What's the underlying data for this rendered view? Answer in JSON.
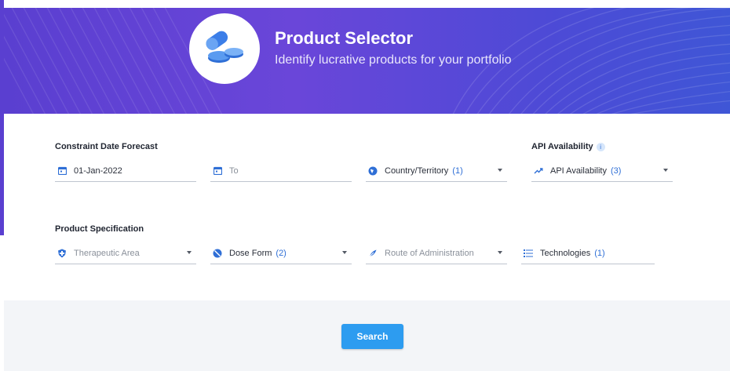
{
  "banner": {
    "title": "Product Selector",
    "subtitle": "Identify lucrative products for your portfolio",
    "logo_icon": "pills-icon"
  },
  "constraint_section": {
    "label": "Constraint Date Forecast",
    "from_date": {
      "icon": "calendar-icon",
      "value": "01-Jan-2022"
    },
    "to_date": {
      "icon": "calendar-icon",
      "placeholder": "To"
    },
    "country": {
      "icon": "globe-icon",
      "label": "Country/Territory",
      "count": "(1)"
    }
  },
  "api_section": {
    "label": "API Availability",
    "info_icon": "info-icon",
    "info_glyph": "i",
    "field": {
      "icon": "trend-icon",
      "label": "API Availability",
      "count": "(3)"
    }
  },
  "product_section": {
    "label": "Product Specification",
    "therapeutic_area": {
      "icon": "shield-icon",
      "placeholder": "Therapeutic Area"
    },
    "dose_form": {
      "icon": "pill-icon",
      "label": "Dose Form",
      "count": "(2)"
    },
    "route": {
      "icon": "route-icon",
      "placeholder": "Route of Administration"
    },
    "technologies": {
      "icon": "list-icon",
      "label": "Technologies",
      "count": "(1)"
    }
  },
  "actions": {
    "search_label": "Search"
  },
  "colors": {
    "accent": "#2d9cf0",
    "banner": "#5a3fd0",
    "count": "#2f6fd6"
  }
}
